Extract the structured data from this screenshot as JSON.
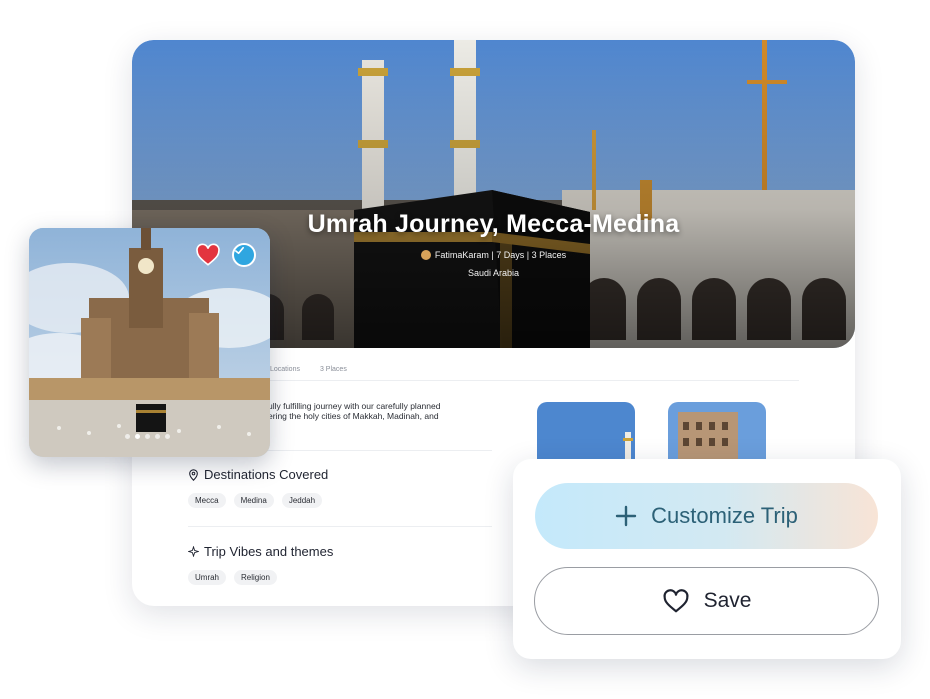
{
  "trip": {
    "title": "Umrah Journey, Mecca-Medina",
    "meta": "FatimaKaram | 7 Days | 3 Places",
    "location": "Saudi Arabia"
  },
  "tabs": [
    {
      "label": "Locations"
    },
    {
      "label": "3 Places"
    }
  ],
  "description": {
    "line1": "ully fulfilling journey with our carefully planned",
    "line2": "ering the holy cities of Makkah, Madinah, and"
  },
  "destinations": {
    "title": "Destinations Covered",
    "chips": [
      "Mecca",
      "Medina",
      "Jeddah"
    ]
  },
  "vibes": {
    "title": "Trip Vibes and themes",
    "chips": [
      "Umrah",
      "Religion"
    ]
  },
  "gallery": {
    "slide_count": 5,
    "active_slide": 1,
    "favorited": true,
    "verified": true
  },
  "actions": {
    "customize_label": "Customize Trip",
    "save_label": "Save"
  },
  "colors": {
    "heart": "#e3343f",
    "check": "#2fa6e0",
    "customize_text": "#2c6177"
  }
}
